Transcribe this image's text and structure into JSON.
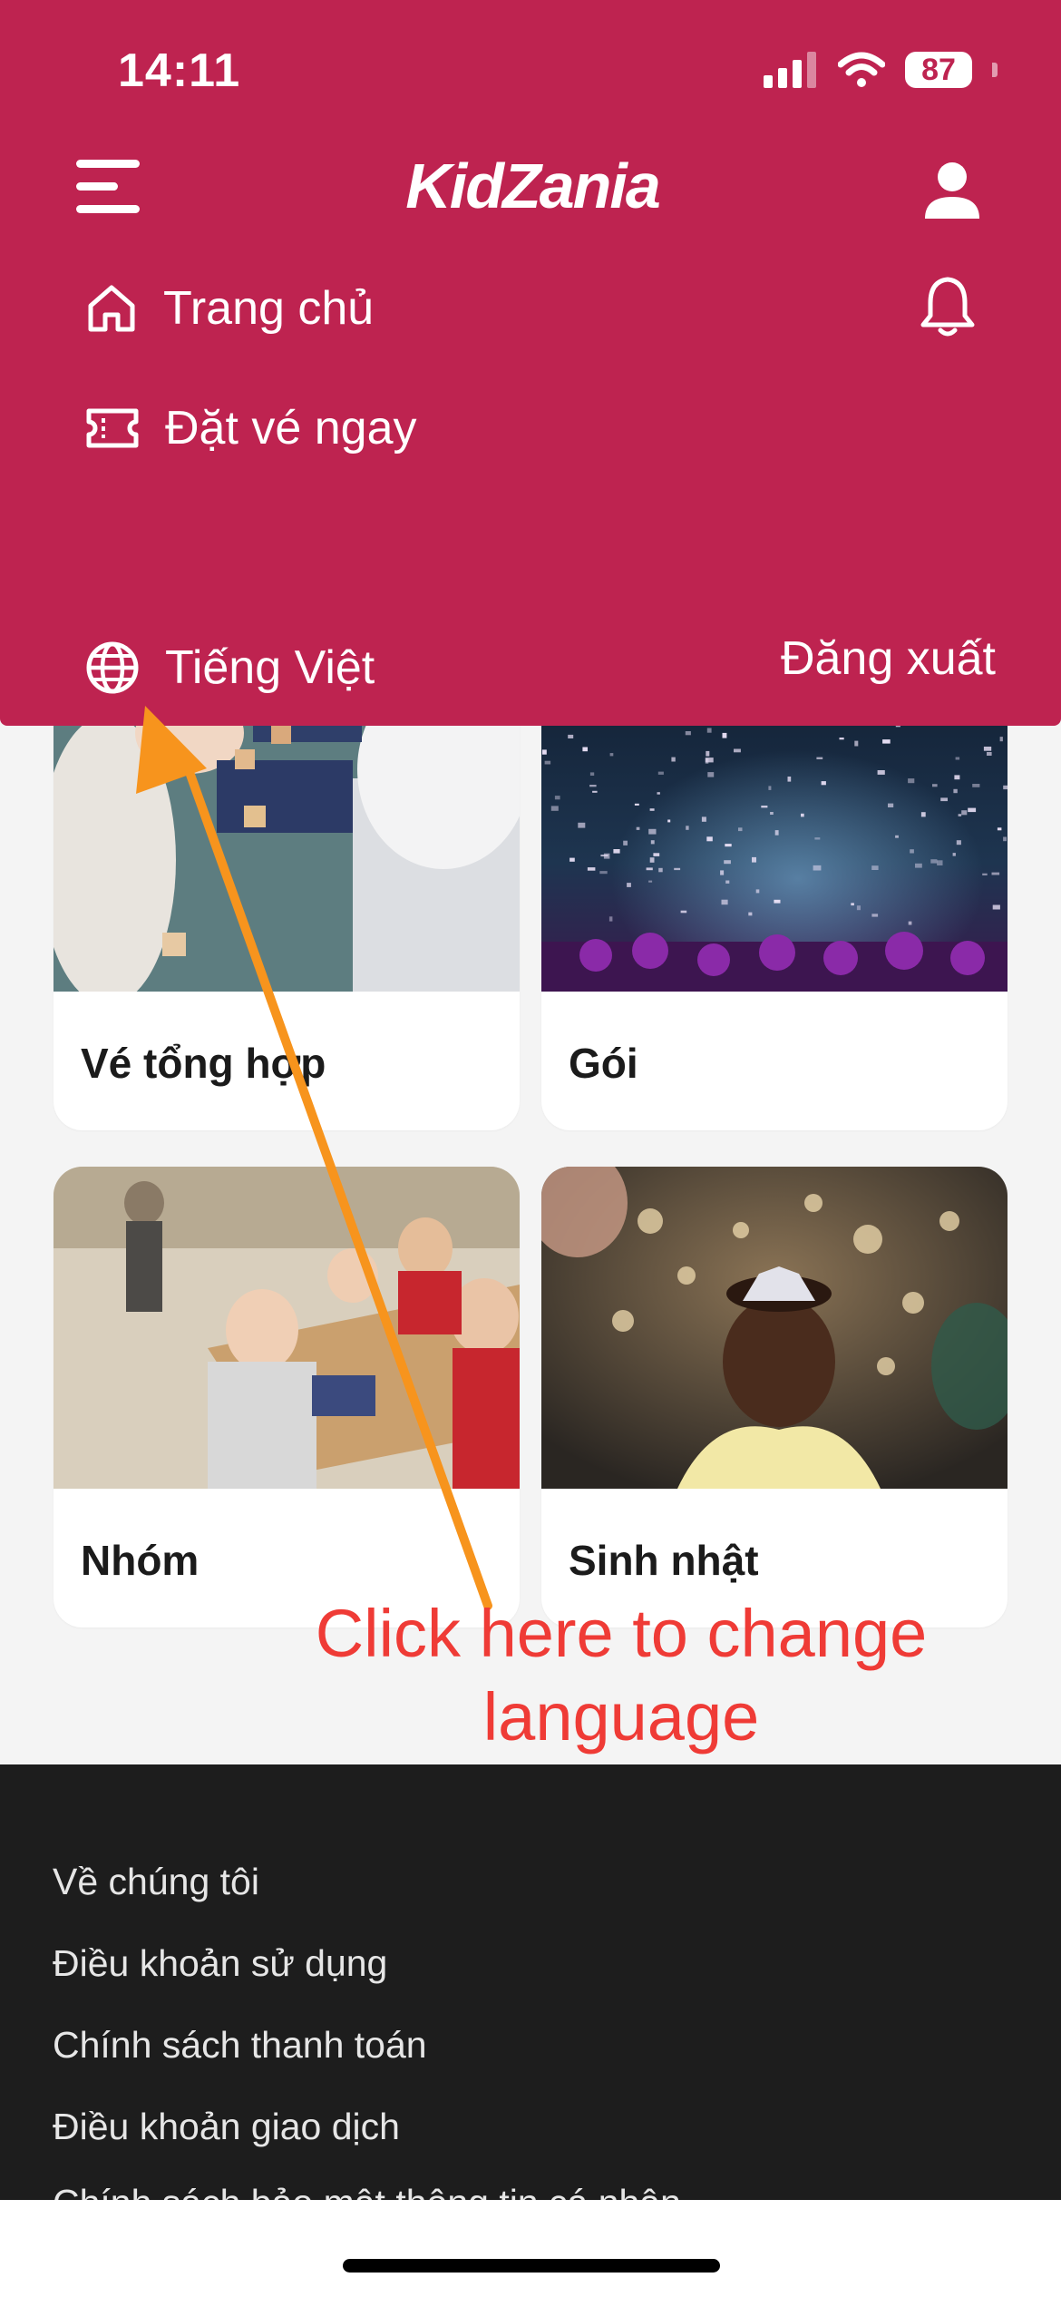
{
  "status_bar": {
    "time": "14:11",
    "battery": "87"
  },
  "header": {
    "logo_text": "KidZania",
    "icons": [
      "hamburger-menu-icon",
      "user-icon"
    ]
  },
  "menu": {
    "items": [
      {
        "label": "Trang chủ",
        "icon": "home-icon"
      },
      {
        "label": "Đặt vé ngay",
        "icon": "ticket-icon"
      }
    ],
    "language": {
      "label": "Tiếng Việt",
      "icon": "globe-icon"
    },
    "logout_label": "Đăng xuất",
    "notification_icon": "bell-icon"
  },
  "cards": [
    {
      "label": "Vé tổng hợp",
      "image": "children-playing-blocks-photo"
    },
    {
      "label": "Gói",
      "image": "confetti-concert-photo"
    },
    {
      "label": "Nhóm",
      "image": "kids-group-table-photo"
    },
    {
      "label": "Sinh nhật",
      "image": "birthday-girl-tiara-photo"
    }
  ],
  "annotation": {
    "line1": "Click here to change",
    "line2": "language",
    "color": "#ef3b36",
    "arrow_color": "#F7941D"
  },
  "footer": {
    "links": [
      "Về chúng tôi",
      "Điều khoản sử dụng",
      "Chính sách thanh toán",
      "Điều khoản giao dịch",
      "Chính sách bảo mật thông tin cá nhân"
    ]
  },
  "colors": {
    "brand": "#BE2350",
    "footer_bg": "#1d1d1d",
    "page_bg": "#f4f4f4"
  }
}
